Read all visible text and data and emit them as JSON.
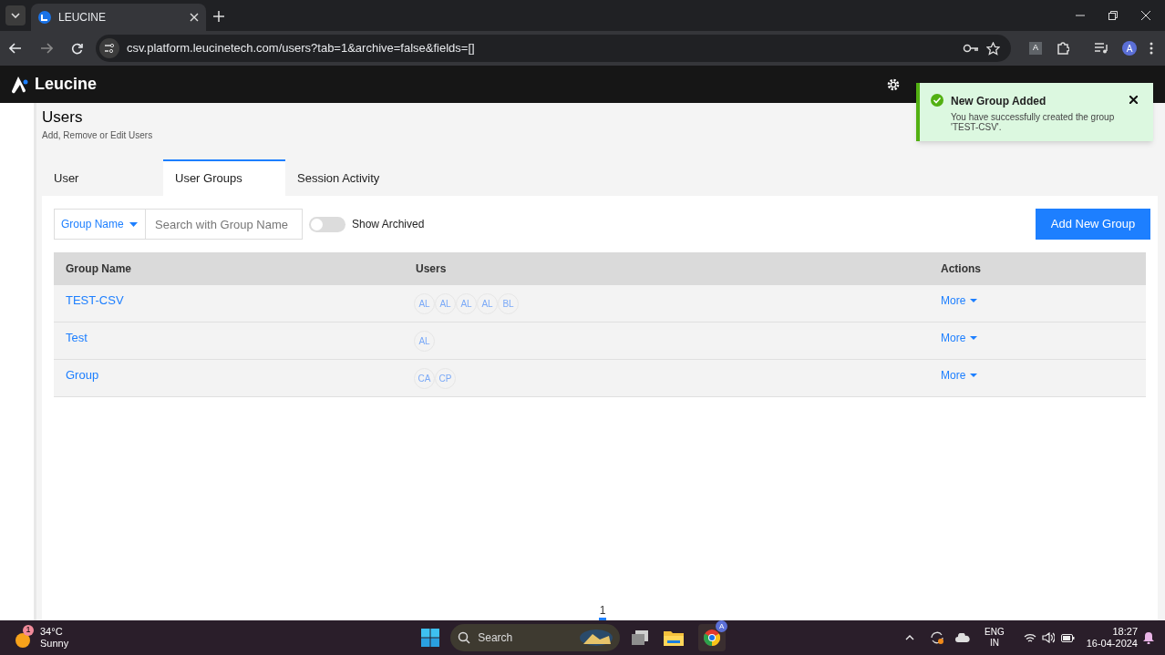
{
  "browser": {
    "tab_title": "LEUCINE",
    "url": "csv.platform.leucinetech.com/users?tab=1&archive=false&fields=[]",
    "profile": "A",
    "ext": "A"
  },
  "app": {
    "logo": "Leucine"
  },
  "toast": {
    "title": "New Group Added",
    "message": "You have successfully created the group 'TEST-CSV'."
  },
  "page": {
    "title": "Users",
    "subtitle": "Add, Remove or Edit Users"
  },
  "tabs": [
    {
      "label": "User",
      "selected": false
    },
    {
      "label": "User Groups",
      "selected": true
    },
    {
      "label": "Session Activity",
      "selected": false
    }
  ],
  "filter": {
    "field": "Group Name",
    "placeholder": "Search with Group Name",
    "show_archived": {
      "label": "Show Archived",
      "on": false
    },
    "add_button": "Add New Group"
  },
  "table": {
    "columns": [
      "Group Name",
      "Users",
      "Actions"
    ],
    "rows": [
      {
        "name": "TEST-CSV",
        "users": [
          "AL",
          "AL",
          "AL",
          "AL",
          "BL"
        ],
        "action": "More"
      },
      {
        "name": "Test",
        "users": [
          "AL"
        ],
        "action": "More"
      },
      {
        "name": "Group",
        "users": [
          "CA",
          "CP"
        ],
        "action": "More"
      }
    ]
  },
  "pagination": {
    "pages": [
      {
        "label": "1",
        "selected": true
      }
    ]
  },
  "taskbar": {
    "weather_badge": "1",
    "temperature": "34°C",
    "condition": "Sunny",
    "search": "Search",
    "chrome_badge": "A",
    "lang": "ENG",
    "region": "IN",
    "time": "18:27",
    "date": "16-04-2024"
  }
}
